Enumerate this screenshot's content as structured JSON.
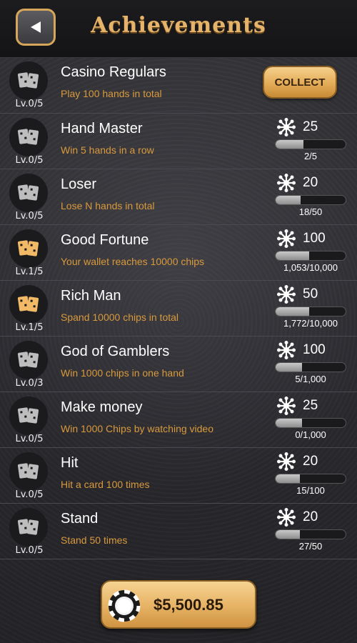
{
  "header": {
    "title": "Achievements",
    "back_icon": "back-arrow-icon"
  },
  "achievements": [
    {
      "name": "Casino Regulars",
      "desc": "Play 100 hands in total",
      "level": "Lv.0/5",
      "active": false,
      "action": "COLLECT"
    },
    {
      "name": "Hand Master",
      "desc": "Win 5 hands in a row",
      "level": "Lv.0/5",
      "active": false,
      "reward": "25",
      "progress": "2/5",
      "fill": 0.4
    },
    {
      "name": "Loser",
      "desc": "Lose N hands in total",
      "level": "Lv.0/5",
      "active": false,
      "reward": "20",
      "progress": "18/50",
      "fill": 0.36
    },
    {
      "name": "Good Fortune",
      "desc": "Your wallet reaches 10000 chips",
      "level": "Lv.1/5",
      "active": true,
      "reward": "100",
      "progress": "1,053/10,000",
      "fill": 0.48
    },
    {
      "name": "Rich Man",
      "desc": "Spand 10000 chips in total",
      "level": "Lv.1/5",
      "active": true,
      "reward": "50",
      "progress": "1,772/10,000",
      "fill": 0.48
    },
    {
      "name": "God of Gamblers",
      "desc": "Win 1000 chips in one hand",
      "level": "Lv.0/3",
      "active": false,
      "reward": "100",
      "progress": "5/1,000",
      "fill": 0.38
    },
    {
      "name": "Make money",
      "desc": "Win 1000 Chips by watching video",
      "level": "Lv.0/5",
      "active": false,
      "reward": "25",
      "progress": "0/1,000",
      "fill": 0.38
    },
    {
      "name": "Hit",
      "desc": "Hit a card 100 times",
      "level": "Lv.0/5",
      "active": false,
      "reward": "20",
      "progress": "15/100",
      "fill": 0.35
    },
    {
      "name": "Stand",
      "desc": "Stand 50 times",
      "level": "Lv.0/5",
      "active": false,
      "reward": "20",
      "progress": "27/50",
      "fill": 0.35
    }
  ],
  "wallet": {
    "amount": "$5,500.85",
    "icon": "poker-chip-icon"
  },
  "colors": {
    "accent": "#e6b36a",
    "desc": "#d99a3d",
    "active_badge": "#f2b966",
    "inactive_badge": "#bdbdbd"
  }
}
